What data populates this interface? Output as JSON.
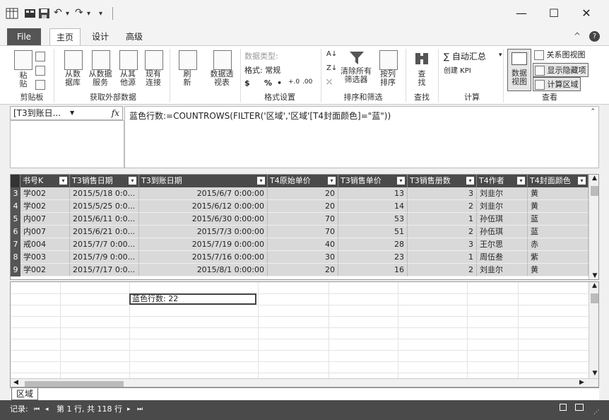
{
  "qat": {
    "undo": "↶",
    "redo": "↷",
    "more": "▾"
  },
  "window": {
    "minimize": "—",
    "maximize": "☐",
    "close": "✕"
  },
  "tabs": [
    {
      "label": "File"
    },
    {
      "label": "主页"
    },
    {
      "label": "设计"
    },
    {
      "label": "高级"
    }
  ],
  "ribbon": {
    "collapse": "^",
    "help": "?",
    "clipboard": {
      "paste_top": "粘",
      "paste_bottom": "贴",
      "group_label": "剪贴板"
    },
    "external": {
      "from_db_1": "从数",
      "from_db_2": "据库",
      "from_service_1": "从数据",
      "from_service_2": "服务",
      "from_other_1": "从其",
      "from_other_2": "他源",
      "existing_1": "现有",
      "existing_2": "连接",
      "group_label": "获取外部数据"
    },
    "refresh_1": "刷",
    "refresh_2": "新",
    "pivot_1": "数据透",
    "pivot_2": "视表",
    "format": {
      "data_type": "数据类型:",
      "format": "格式: 常规",
      "currency": "$",
      "percent": "%",
      "comma": "•",
      "inc": "+.0",
      "dec": ".00",
      "group_label": "格式设置"
    },
    "sort": {
      "clear_1": "清除所有",
      "clear_2": "筛选器",
      "sortcol_1": "按列",
      "sortcol_2": "排序",
      "group_label": "排序和筛选"
    },
    "find": {
      "label": "查找",
      "label_1": "查",
      "label_2": "找",
      "group_label": "查找"
    },
    "calc": {
      "autosum": "∑ 自动汇总",
      "kpi": "创建 KPI",
      "group_label": "计算"
    },
    "view": {
      "data_view_1": "数据",
      "data_view_2": "视图",
      "diagram": "关系图视图",
      "show_hidden": "显示隐藏项",
      "calc_area": "计算区域",
      "group_label": "查看"
    }
  },
  "namebox": "[T3到账日...",
  "fx": "fx",
  "formula": "蓝色行数:=COUNTROWS(FILTER('区域','区域'[T4封面颜色]=\"蓝\"))",
  "columns": [
    "书号K",
    "T3销售日期",
    "T3到账日期",
    "T4原始单价",
    "T3销售单价",
    "T3销售册数",
    "T4作者",
    "T4封面颜色"
  ],
  "rows": [
    {
      "num": "3",
      "k": "学002",
      "sale": "2015/5/18 0:0...",
      "pay": "2015/6/7 0:00:00",
      "orig": "20",
      "price": "13",
      "qty": "3",
      "author": "刘韭尔",
      "color": "黄"
    },
    {
      "num": "4",
      "k": "学002",
      "sale": "2015/5/25 0:0...",
      "pay": "2015/6/12 0:00:00",
      "orig": "20",
      "price": "14",
      "qty": "2",
      "author": "刘韭尔",
      "color": "黄"
    },
    {
      "num": "5",
      "k": "内007",
      "sale": "2015/6/11 0:0...",
      "pay": "2015/6/30 0:00:00",
      "orig": "70",
      "price": "53",
      "qty": "1",
      "author": "孙伍琪",
      "color": "蓝"
    },
    {
      "num": "6",
      "k": "内007",
      "sale": "2015/6/21 0:0...",
      "pay": "2015/7/3 0:00:00",
      "orig": "70",
      "price": "51",
      "qty": "2",
      "author": "孙伍琪",
      "color": "蓝"
    },
    {
      "num": "7",
      "k": "戒004",
      "sale": "2015/7/7 0:00...",
      "pay": "2015/7/19 0:00:00",
      "orig": "40",
      "price": "28",
      "qty": "3",
      "author": "王尔思",
      "color": "赤"
    },
    {
      "num": "8",
      "k": "学003",
      "sale": "2015/7/9 0:00...",
      "pay": "2015/7/16 0:00:00",
      "orig": "30",
      "price": "23",
      "qty": "1",
      "author": "周伍叁",
      "color": "紫"
    },
    {
      "num": "9",
      "k": "学002",
      "sale": "2015/7/17 0:0...",
      "pay": "2015/8/1 0:00:00",
      "orig": "20",
      "price": "16",
      "qty": "2",
      "author": "刘韭尔",
      "color": "黄"
    }
  ],
  "measure": "蓝色行数: 22",
  "sheet_tab": "区域",
  "status": {
    "record": "记录:",
    "first": "⏮",
    "prev": "◂",
    "position": "第 1 行, 共 118 行",
    "next": "▸",
    "last": "⏭"
  }
}
